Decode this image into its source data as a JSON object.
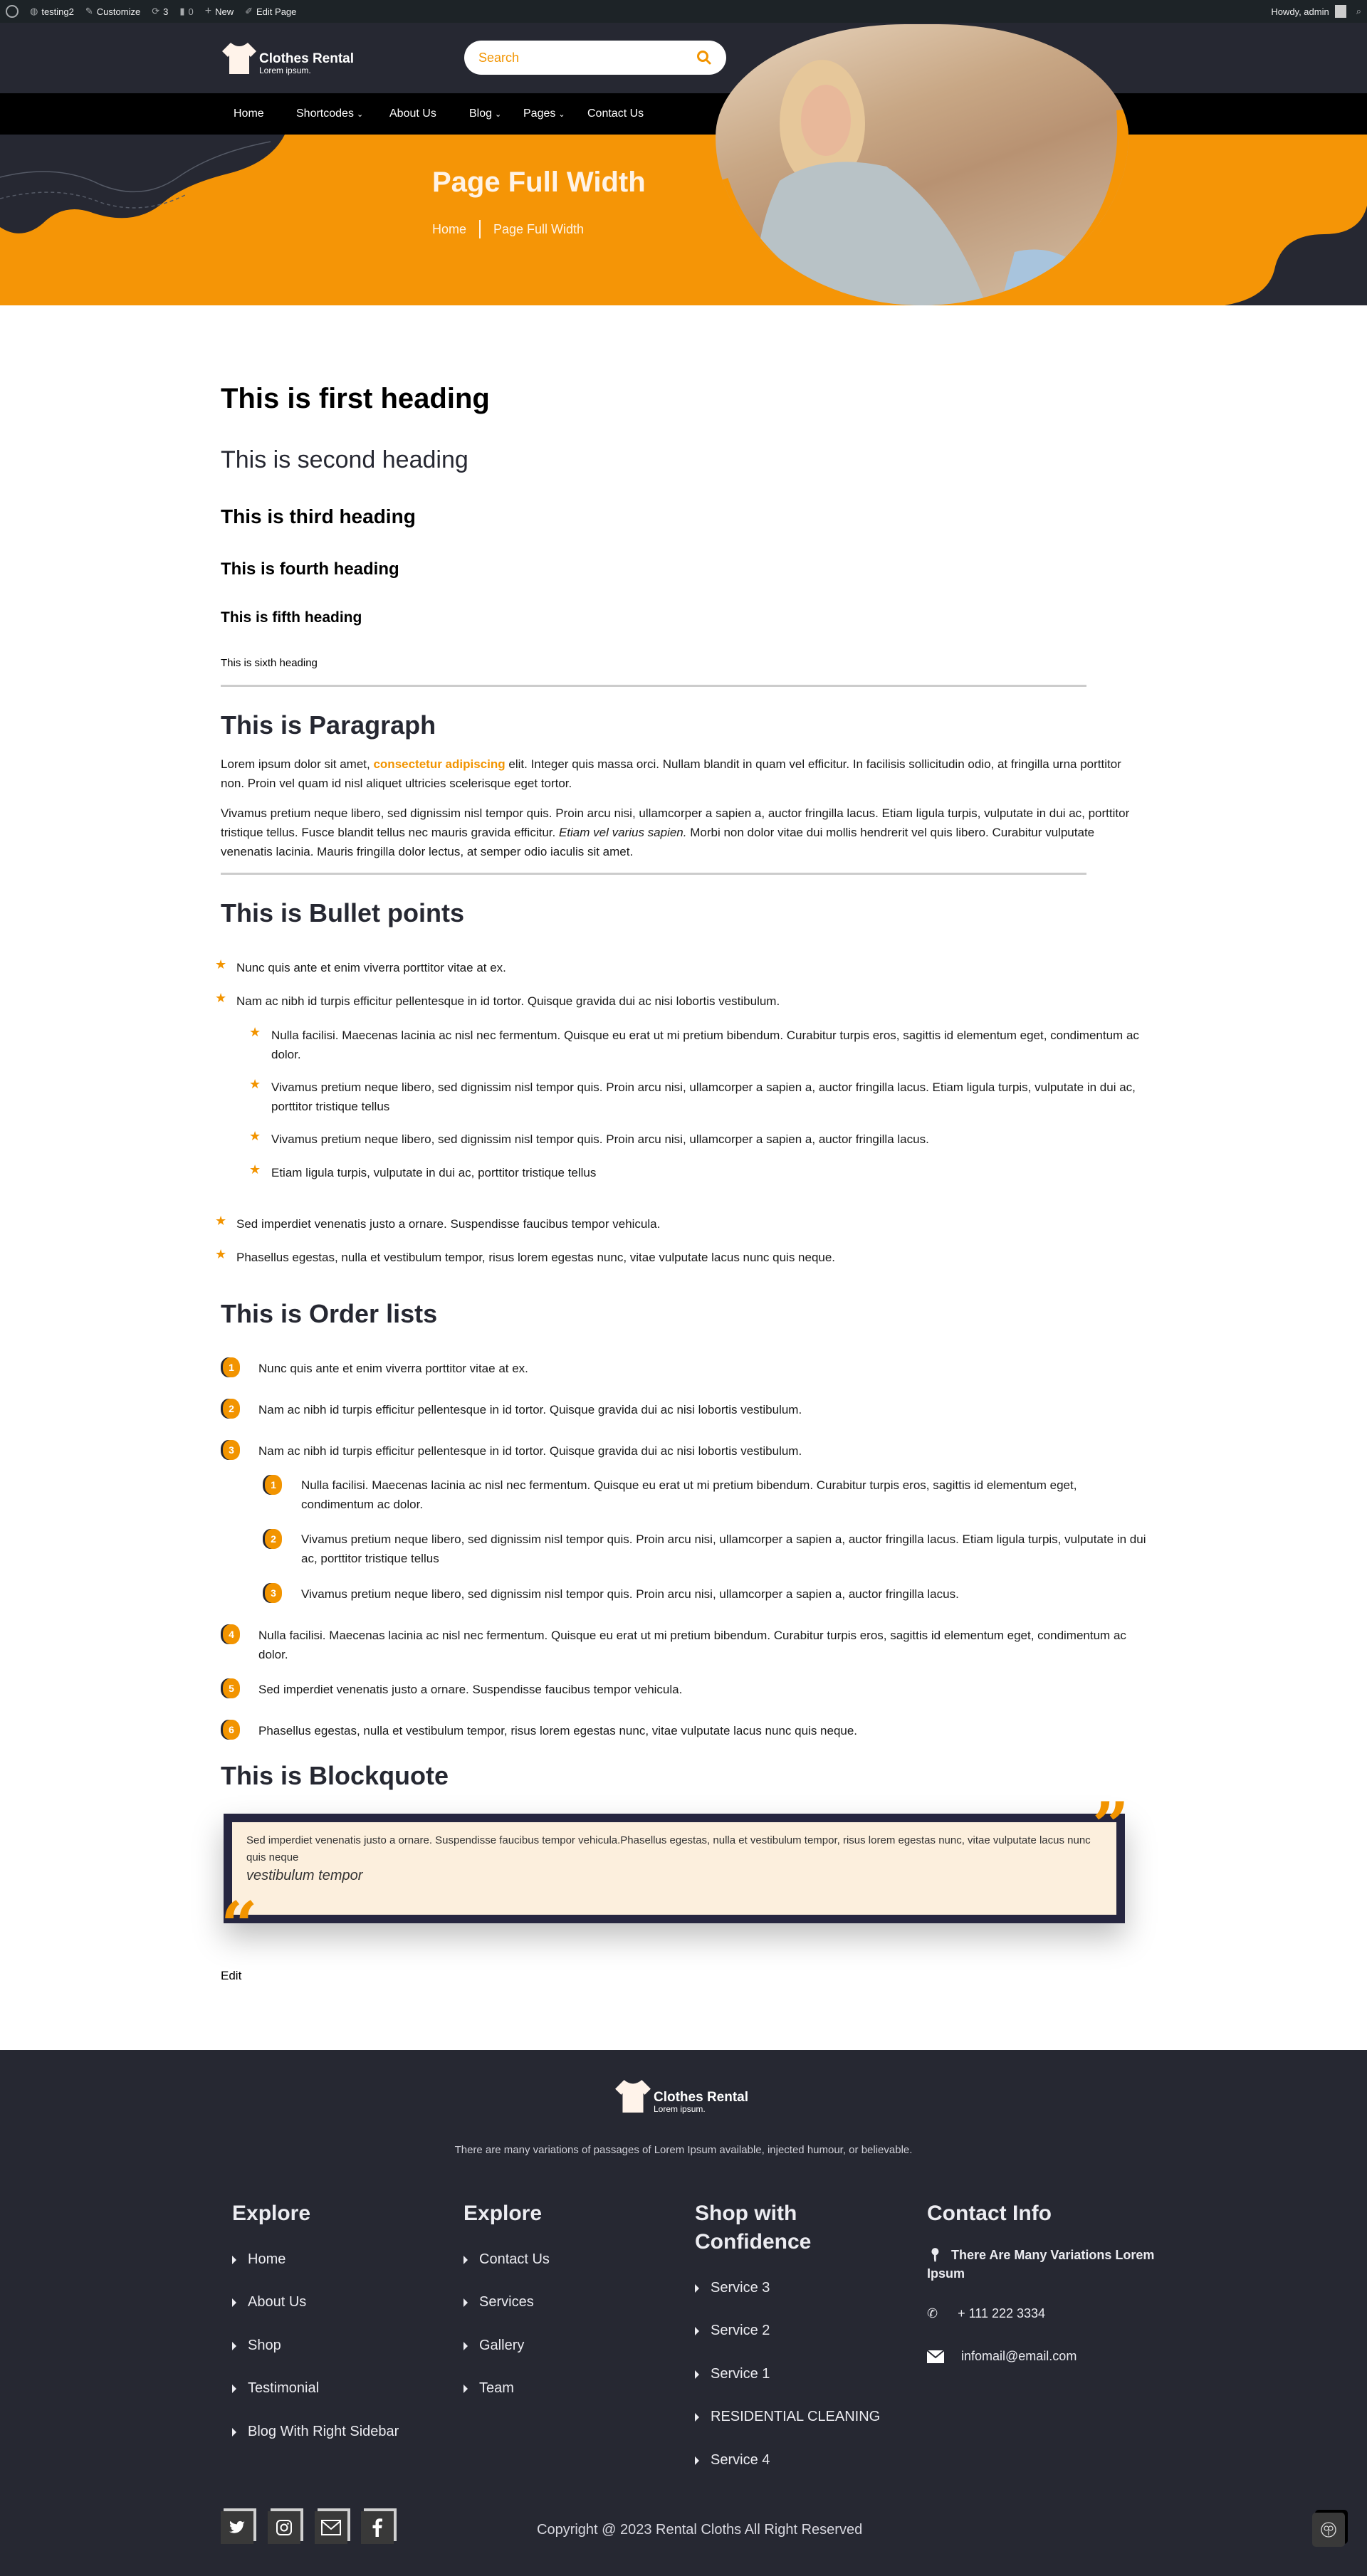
{
  "admin_bar": {
    "site_name": "testing2",
    "customize": "Customize",
    "updates_count": "3",
    "comments_count": "0",
    "new": "New",
    "edit_page": "Edit Page",
    "howdy": "Howdy, admin"
  },
  "header": {
    "logo_title": "Clothes Rental",
    "logo_tagline": "Lorem ipsum.",
    "search_placeholder": "Search"
  },
  "nav": {
    "items": [
      {
        "label": "Home",
        "has_dropdown": false
      },
      {
        "label": "Shortcodes",
        "has_dropdown": true
      },
      {
        "label": "About Us",
        "has_dropdown": false
      },
      {
        "label": "Blog",
        "has_dropdown": true
      },
      {
        "label": "Pages",
        "has_dropdown": true
      },
      {
        "label": "Contact Us",
        "has_dropdown": false
      }
    ]
  },
  "hero": {
    "title": "Page Full Width",
    "breadcrumb": [
      "Home",
      "Page Full Width"
    ]
  },
  "headings": [
    "This is first heading",
    "This is second heading",
    "This is third heading",
    "This is fourth heading",
    "This is fifth heading",
    "This is sixth heading"
  ],
  "paragraph_section": {
    "title": "This is Paragraph",
    "p1_before": "Lorem ipsum dolor sit amet, ",
    "p1_highlight": "consectetur adipiscing",
    "p1_after": " elit. Integer quis massa orci. Nullam blandit in quam vel efficitur. In facilisis sollicitudin odio, at fringilla urna porttitor non. Proin vel quam id nisl aliquet ultricies scelerisque eget tortor.",
    "p2_before": "Vivamus pretium neque libero, sed dignissim nisl tempor quis. Proin arcu nisi, ullamcorper a sapien a, auctor fringilla lacus. Etiam ligula turpis, vulputate in dui ac, porttitor tristique tellus. Fusce blandit tellus nec mauris gravida efficitur. ",
    "p2_italic": "Etiam vel varius sapien.",
    "p2_after": " Morbi non dolor vitae dui mollis hendrerit vel quis libero. Curabitur vulputate venenatis lacinia. Mauris fringilla dolor lectus, at semper odio iaculis sit amet."
  },
  "bullets": {
    "title": "This is Bullet points",
    "items": [
      "Nunc quis ante et enim viverra porttitor vitae at ex.",
      "Nam ac nibh id turpis efficitur pellentesque in id tortor. Quisque gravida dui ac nisi lobortis vestibulum.",
      "Sed imperdiet venenatis justo a ornare. Suspendisse faucibus tempor vehicula.",
      "Phasellus egestas, nulla et vestibulum tempor, risus lorem egestas nunc, vitae vulputate lacus nunc quis neque."
    ],
    "sub_items": [
      "Nulla facilisi. Maecenas lacinia ac nisl nec fermentum. Quisque eu erat ut mi pretium bibendum. Curabitur turpis eros, sagittis id elementum eget, condimentum ac dolor.",
      "Vivamus pretium neque libero, sed dignissim nisl tempor quis. Proin arcu nisi, ullamcorper a sapien a, auctor fringilla lacus. Etiam ligula turpis, vulputate in dui ac, porttitor tristique tellus",
      "Vivamus pretium neque libero, sed dignissim nisl tempor quis. Proin arcu nisi, ullamcorper a sapien a, auctor fringilla lacus.",
      "Etiam ligula turpis, vulputate in dui ac, porttitor tristique tellus"
    ]
  },
  "ordered": {
    "title": "This is Order lists",
    "items": [
      {
        "n": "1",
        "text": "Nunc quis ante et enim viverra porttitor vitae at ex."
      },
      {
        "n": "2",
        "text": "Nam ac nibh id turpis efficitur pellentesque in id tortor. Quisque gravida dui ac nisi lobortis vestibulum."
      },
      {
        "n": "3",
        "text": "Nam ac nibh id turpis efficitur pellentesque in id tortor. Quisque gravida dui ac nisi lobortis vestibulum."
      },
      {
        "n": "4",
        "text": "Nulla facilisi. Maecenas lacinia ac nisl nec fermentum. Quisque eu erat ut mi pretium bibendum. Curabitur turpis eros, sagittis id elementum eget, condimentum ac dolor."
      },
      {
        "n": "5",
        "text": "Sed imperdiet venenatis justo a ornare. Suspendisse faucibus tempor vehicula."
      },
      {
        "n": "6",
        "text": "Phasellus egestas, nulla et vestibulum tempor, risus lorem egestas nunc, vitae vulputate lacus nunc quis neque."
      }
    ],
    "sub_items": [
      {
        "n": "1",
        "text": "Nulla facilisi. Maecenas lacinia ac nisl nec fermentum. Quisque eu erat ut mi pretium bibendum. Curabitur turpis eros, sagittis id elementum eget, condimentum ac dolor."
      },
      {
        "n": "2",
        "text": "Vivamus pretium neque libero, sed dignissim nisl tempor quis. Proin arcu nisi, ullamcorper a sapien a, auctor fringilla lacus. Etiam ligula turpis, vulputate in dui ac, porttitor tristique tellus"
      },
      {
        "n": "3",
        "text": "Vivamus pretium neque libero, sed dignissim nisl tempor quis. Proin arcu nisi, ullamcorper a sapien a, auctor fringilla lacus."
      }
    ]
  },
  "blockquote": {
    "title": "This is Blockquote",
    "text": "Sed imperdiet venenatis justo a ornare. Suspendisse faucibus tempor vehicula.Phasellus egestas, nulla et vestibulum tempor, risus lorem egestas nunc, vitae vulputate lacus nunc quis neque",
    "cite": "vestibulum tempor"
  },
  "edit_link": "Edit",
  "footer": {
    "logo_title": "Clothes Rental",
    "logo_tagline": "Lorem ipsum.",
    "description": "There are many variations of passages of Lorem Ipsum available, injected humour, or believable.",
    "columns": [
      {
        "title": "Explore",
        "links": [
          "Home",
          "About Us",
          "Shop",
          "Testimonial",
          "Blog With Right Sidebar"
        ]
      },
      {
        "title": "Explore",
        "links": [
          "Contact Us",
          "Services",
          "Gallery",
          "Team"
        ]
      },
      {
        "title": "Shop with Confidence",
        "links": [
          "Service 3",
          "Service 2",
          "Service 1",
          "RESIDENTIAL CLEANING",
          "Service 4"
        ]
      }
    ],
    "contact": {
      "title": "Contact Info",
      "address": "There Are Many Variations Lorem Ipsum",
      "phone": "+ 111 222 3334",
      "email": "infomail@email.com"
    },
    "social": [
      "twitter",
      "instagram",
      "email",
      "facebook"
    ],
    "copyright": "Copyright @ 2023 Rental Cloths All Right Reserved"
  },
  "colors": {
    "accent": "#f29400",
    "dark": "#262832",
    "nav_bg": "#000000",
    "quote_bg": "#fcefdd"
  }
}
